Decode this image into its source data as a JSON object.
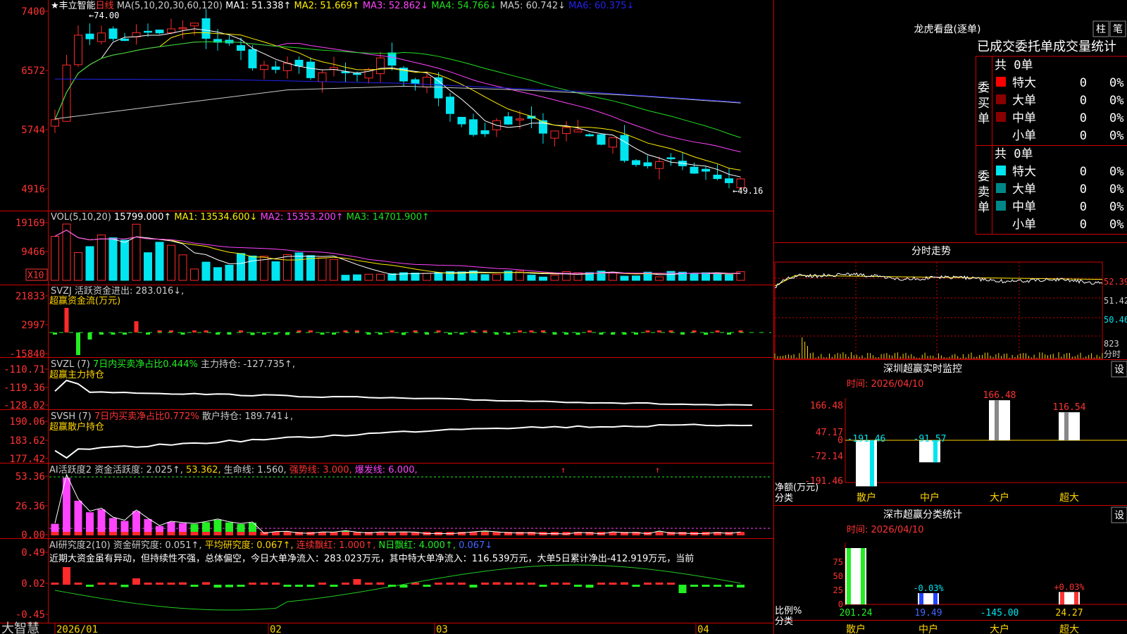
{
  "colors": {
    "up": "#ff2a2a",
    "down": "#00e5f0",
    "grid": "#d00000",
    "ma1": "#ffffff",
    "ma2": "#ffee00",
    "ma3": "#ff44ff",
    "ma4": "#22dd22",
    "ma5": "#cccccc",
    "ma6": "#2222ee",
    "text": "#cccccc",
    "yellow": "#ffd500",
    "red": "#ff3333",
    "green": "#22ee22",
    "magenta": "#ff44ff",
    "blue": "#4466ff"
  },
  "stock": {
    "star": "★",
    "name": "丰立智能",
    "period": "日线"
  },
  "ma_header": [
    {
      "t": "MA(5,10,20,30,60,120)",
      "c": "text"
    },
    {
      "t": "MA1: 51.338↑",
      "c": "ma1"
    },
    {
      "t": "MA2: 51.669↑",
      "c": "ma2"
    },
    {
      "t": "MA3: 52.862↓",
      "c": "ma3"
    },
    {
      "t": "MA4: 54.766↓",
      "c": "ma4"
    },
    {
      "t": "MA5: 60.742↓",
      "c": "ma5"
    },
    {
      "t": "MA6: 60.375↓",
      "c": "ma6"
    }
  ],
  "price_axis": [
    "7400",
    "6572",
    "5744",
    "4916"
  ],
  "price_high_label": "74.00",
  "price_low_label": "49.16",
  "vol": {
    "header": [
      {
        "t": "VOL(5,10,20)",
        "c": "text"
      },
      {
        "t": "15799.000↑",
        "c": "ma1"
      },
      {
        "t": "MA1: 13534.600↓",
        "c": "ma2"
      },
      {
        "t": "MA2: 15353.200↑",
        "c": "ma3"
      },
      {
        "t": "MA3: 14701.900↑",
        "c": "ma4"
      }
    ],
    "axis": [
      "19169",
      "9466"
    ],
    "unit": "X10"
  },
  "svzj": {
    "line1": [
      {
        "t": "SVZJ  活跃资金进出: 283.016↓,",
        "c": "text"
      }
    ],
    "line2": "超赢资金流(万元)",
    "axis": [
      "21833",
      "2997",
      "-15840"
    ]
  },
  "svzl": {
    "header": [
      {
        "t": "SVZL (7)",
        "c": "text"
      },
      {
        "t": "7日内买卖净占比0.444%",
        "c": "green"
      },
      {
        "t": "主力持仓: -127.735↑,",
        "c": "text"
      }
    ],
    "line2": "超赢主力持仓",
    "axis": [
      "-110.71",
      "-119.36",
      "-128.02"
    ]
  },
  "svsh": {
    "header": [
      {
        "t": "SVSH (7)",
        "c": "text"
      },
      {
        "t": "7日内买卖净占比0.772%",
        "c": "red"
      },
      {
        "t": "散户持仓: 189.741↓,",
        "c": "text"
      }
    ],
    "line2": "超赢散户持仓",
    "axis": [
      "190.06",
      "183.62",
      "177.42"
    ]
  },
  "ai1": {
    "header": [
      {
        "t": "AI活跃度2 资金活跃度: 2.025↑,",
        "c": "text"
      },
      {
        "t": "53.362,",
        "c": "yellow"
      },
      {
        "t": "生命线: 1.560,",
        "c": "text"
      },
      {
        "t": "强势线: 3.000,",
        "c": "red"
      },
      {
        "t": "爆发线: 6.000,",
        "c": "magenta"
      }
    ],
    "axis": [
      "53.36",
      "26.36",
      "0.00"
    ]
  },
  "ai2": {
    "header": [
      {
        "t": "AI研究度2(10) 资金研究度: 0.051↑,",
        "c": "text"
      },
      {
        "t": "平均研究度: 0.067↑,",
        "c": "yellow"
      },
      {
        "t": "连续飘红: 1.000↑,",
        "c": "red"
      },
      {
        "t": "N日飘红: 4.000↑,",
        "c": "green"
      },
      {
        "t": "0.067↓",
        "c": "blue"
      }
    ],
    "commentary": "近期大资金虽有异动，但持续性不强，总体偏空，今日大单净流入：283.023万元，其中特大单净流入：116.539万元，大单5日累计净出-412.919万元，当前",
    "axis": [
      "0.49",
      "0.02",
      "-0.45"
    ]
  },
  "date_axis": [
    "2026/01",
    "02",
    "03",
    "04"
  ],
  "brand": "大智慧",
  "dragon": {
    "title": "龙虎看盘(逐单)",
    "btn1": "柱",
    "btn2": "笔",
    "header": "已成交委托单成交量统计",
    "buy_group": "委买单",
    "sell_group": "委卖单",
    "buy_total": "共 0单",
    "sell_total": "共 0单",
    "rows": [
      {
        "label": "特大",
        "val": "0",
        "pct": "0%"
      },
      {
        "label": "大单",
        "val": "0",
        "pct": "0%"
      },
      {
        "label": "中单",
        "val": "0",
        "pct": "0%"
      },
      {
        "label": "小单",
        "val": "0",
        "pct": "0%"
      }
    ]
  },
  "intraday": {
    "title": "分时走势",
    "axis": [
      "52.39",
      "51.42",
      "50.46"
    ],
    "vol_max": "823",
    "vol_unit": "分时"
  },
  "monitor": {
    "title": "深圳超赢实时监控",
    "btn": "设",
    "time": "时间: 2026/04/10",
    "axis": [
      "166.48",
      "47.17",
      "0",
      "-72.14",
      "-191.46"
    ],
    "ylabel1": "净额(万元)",
    "ylabel2": "分类",
    "bars": [
      {
        "label": "散户",
        "value": -191.46,
        "text": "-191.46"
      },
      {
        "label": "中户",
        "value": -91.57,
        "text": "-91.57"
      },
      {
        "label": "大户",
        "value": 166.48,
        "text": "166.48"
      },
      {
        "label": "超大",
        "value": 116.54,
        "text": "116.54"
      }
    ]
  },
  "classify": {
    "title": "深市超赢分类统计",
    "btn": "设",
    "time": "时间: 2026/04/10",
    "axis": [
      "75",
      "50",
      "25",
      "0"
    ],
    "ylabel1": "比例%",
    "ylabel2": "分类",
    "bars": [
      {
        "label": "散户",
        "pct": 100,
        "pct_text": "",
        "value": "201.24"
      },
      {
        "label": "中户",
        "pct": 20,
        "pct_text": "-0.03%",
        "value": "19.49"
      },
      {
        "label": "大户",
        "pct": 0,
        "pct_text": "",
        "value": "-145.00"
      },
      {
        "label": "超大",
        "pct": 22,
        "pct_text": "+0.03%",
        "value": "24.27"
      }
    ]
  }
}
